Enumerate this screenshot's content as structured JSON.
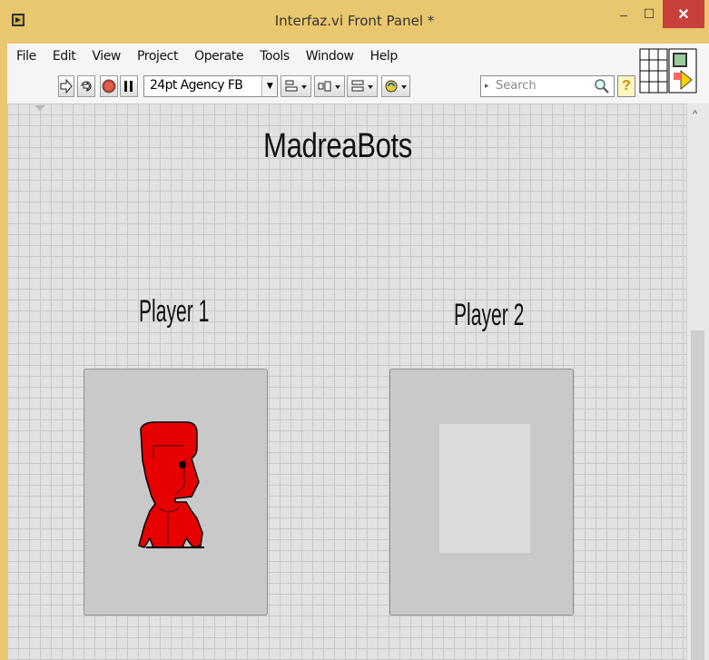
{
  "window": {
    "title": "Interfaz.vi Front Panel *",
    "minimize": "‒",
    "maximize": "☐",
    "close": "✕"
  },
  "menu": [
    "File",
    "Edit",
    "View",
    "Project",
    "Operate",
    "Tools",
    "Window",
    "Help"
  ],
  "toolbar": {
    "font": "24pt Agency FB",
    "search_placeholder": "Search",
    "help_label": "?"
  },
  "panel": {
    "heading": "MadreaBots",
    "players": [
      {
        "label": "Player 1",
        "color": "#e60000",
        "stroke": "#7a0000"
      },
      {
        "label": "Player 2",
        "color": "#0b3fe0",
        "stroke": "#002080"
      }
    ]
  },
  "colors": {
    "titlebar": "#e9c76e",
    "close": "#c7413a",
    "grid": "#c8c8c8"
  }
}
